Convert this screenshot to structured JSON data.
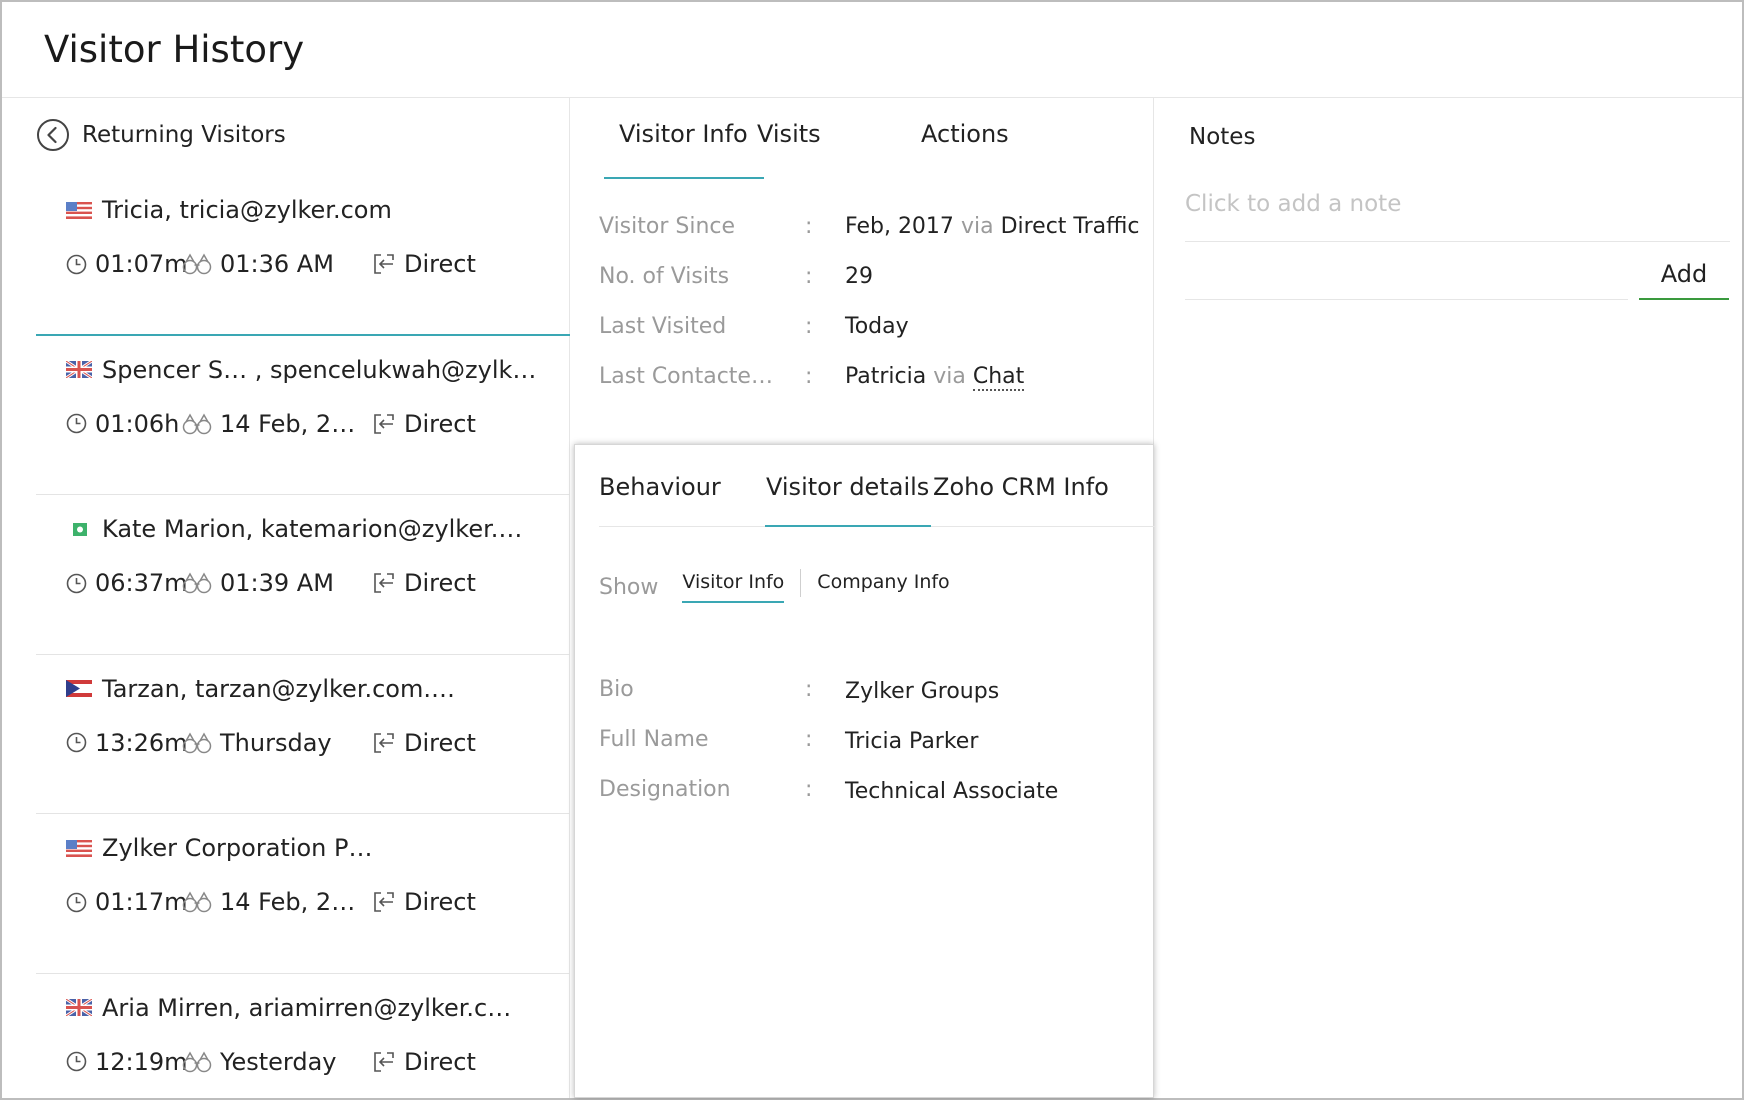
{
  "header": {
    "title": "Visitor History"
  },
  "left": {
    "back_label": "Returning Visitors",
    "visitors": [
      {
        "flag": "us-flag",
        "name": "Tricia, tricia@zylker.com",
        "duration": "01:07m",
        "seen": "01:36 AM",
        "source": "Direct"
      },
      {
        "flag": "uk-flag",
        "name": "Spencer S… , spencelukwah@zylk…",
        "duration": "01:06h",
        "seen": "14 Feb, 2…",
        "source": "Direct"
      },
      {
        "flag": "green-flag",
        "name": "Kate Marion, katemarion@zylker.…",
        "duration": "06:37m",
        "seen": "01:39 AM",
        "source": "Direct"
      },
      {
        "flag": "red-blue-flag",
        "name": "Tarzan, tarzan@zylker.com.…",
        "duration": "13:26m",
        "seen": "Thursday",
        "source": "Direct"
      },
      {
        "flag": "us-flag",
        "name": "Zylker Corporation P…",
        "duration": "01:17m",
        "seen": "14 Feb, 2…",
        "source": "Direct"
      },
      {
        "flag": "uk-flag",
        "name": "Aria Mirren, ariamirren@zylker.c…",
        "duration": "12:19m",
        "seen": "Yesterday",
        "source": "Direct"
      }
    ]
  },
  "middle": {
    "tabs": {
      "visitor_info": "Visitor Info",
      "visits": "Visits",
      "actions": "Actions"
    },
    "info": {
      "visitor_since_label": "Visitor Since",
      "visitor_since_date": "Feb, 2017",
      "visitor_since_via": "via",
      "visitor_since_source": "Direct Traffic",
      "visits_label": "No. of Visits",
      "visits_value": "29",
      "last_visited_label": "Last Visited",
      "last_visited_value": "Today",
      "last_contacted_label": "Last Contacte…",
      "last_contacted_name": "Patricia",
      "last_contacted_via": "via",
      "last_contacted_channel": "Chat",
      "colon": ":"
    }
  },
  "panel": {
    "tabs": {
      "behaviour": "Behaviour",
      "visitor_details": "Visitor details",
      "crm": "Zoho CRM Info"
    },
    "show_label": "Show",
    "show_visitor": "Visitor Info",
    "show_company": "Company Info",
    "fields": [
      {
        "label": "Bio",
        "value": "Zylker Groups"
      },
      {
        "label": "Full Name",
        "value": "Tricia Parker"
      },
      {
        "label": "Designation",
        "value": "Technical Associate"
      }
    ]
  },
  "notes": {
    "title": "Notes",
    "placeholder": "Click to add a note",
    "add_label": "Add"
  },
  "colors": {
    "accent": "#3aa7b4",
    "add_underline": "#3a9a3e",
    "muted": "#9a9a9a"
  }
}
